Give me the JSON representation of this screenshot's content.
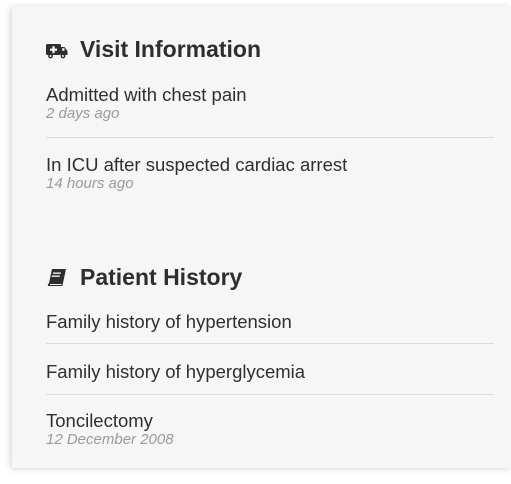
{
  "visit": {
    "heading": "Visit Information",
    "icon": "ambulance-icon",
    "items": [
      {
        "title": "Admitted with chest pain",
        "meta": "2 days ago"
      },
      {
        "title": "In ICU after suspected cardiac arrest",
        "meta": "14 hours ago"
      }
    ]
  },
  "history": {
    "heading": "Patient History",
    "icon": "book-icon",
    "items": [
      {
        "title": "Family history of hypertension"
      },
      {
        "title": "Family history of hyperglycemia"
      },
      {
        "title": "Toncilectomy",
        "meta": "12 December 2008"
      }
    ]
  }
}
